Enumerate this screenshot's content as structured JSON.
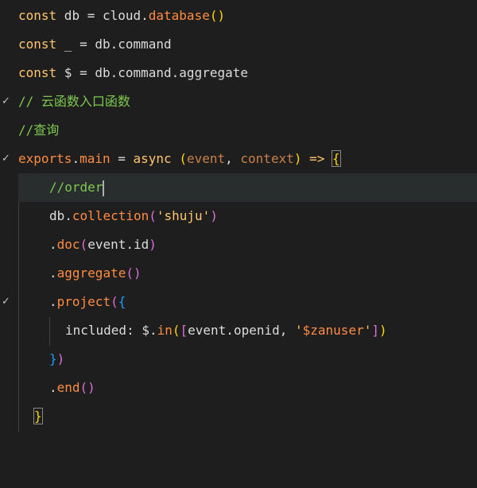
{
  "lines": [
    {
      "id": 1,
      "tokens": [
        "const",
        " db = cloud.",
        "database",
        "()"
      ]
    },
    {
      "id": 2,
      "tokens": [
        "const",
        " _ = db.command"
      ]
    },
    {
      "id": 3,
      "tokens": [
        "const",
        " $ = db.command.aggregate"
      ]
    },
    {
      "id": 4,
      "tokens": [
        "// 云函数入口函数"
      ]
    },
    {
      "id": 5,
      "tokens": [
        "//查询"
      ]
    },
    {
      "id": 6,
      "tokens": [
        "exports",
        ".",
        "main",
        " = ",
        "async",
        " ",
        "(",
        "event",
        ", ",
        "context",
        ")",
        " => ",
        "{"
      ]
    },
    {
      "id": 7,
      "tokens": [
        "//order"
      ]
    },
    {
      "id": 8,
      "tokens": [
        "db.",
        "collection",
        "(",
        "'shuju'",
        ")"
      ]
    },
    {
      "id": 9,
      "tokens": [
        ".",
        "doc",
        "(",
        "event.id",
        ")"
      ]
    },
    {
      "id": 10,
      "tokens": [
        ".",
        "aggregate",
        "()"
      ]
    },
    {
      "id": 11,
      "tokens": [
        ".",
        "project",
        "(",
        "{"
      ]
    },
    {
      "id": 12,
      "tokens": [
        "included: $.",
        "in",
        "(",
        "[",
        "event.openid, ",
        "'",
        "$zanuser",
        "'",
        "]",
        ")"
      ]
    },
    {
      "id": 13,
      "tokens": [
        "}",
        ")"
      ]
    },
    {
      "id": 14,
      "tokens": [
        ".",
        "end",
        "()"
      ]
    },
    {
      "id": 15,
      "tokens": [
        "}"
      ]
    }
  ],
  "gutter": {
    "fold_mark": "✓"
  }
}
